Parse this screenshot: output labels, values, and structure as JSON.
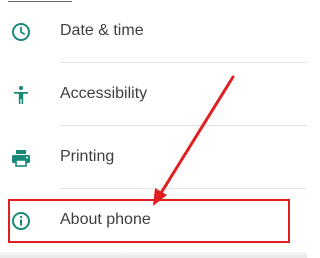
{
  "settings": {
    "items": [
      {
        "label": "Date & time",
        "icon": "clock-icon"
      },
      {
        "label": "Accessibility",
        "icon": "accessibility-icon"
      },
      {
        "label": "Printing",
        "icon": "printer-icon"
      },
      {
        "label": "About phone",
        "icon": "info-icon"
      }
    ]
  },
  "colors": {
    "accent": "#3aa08c",
    "icon": "#1a8a78",
    "annotation": "#e02020",
    "text": "#3c4043"
  }
}
